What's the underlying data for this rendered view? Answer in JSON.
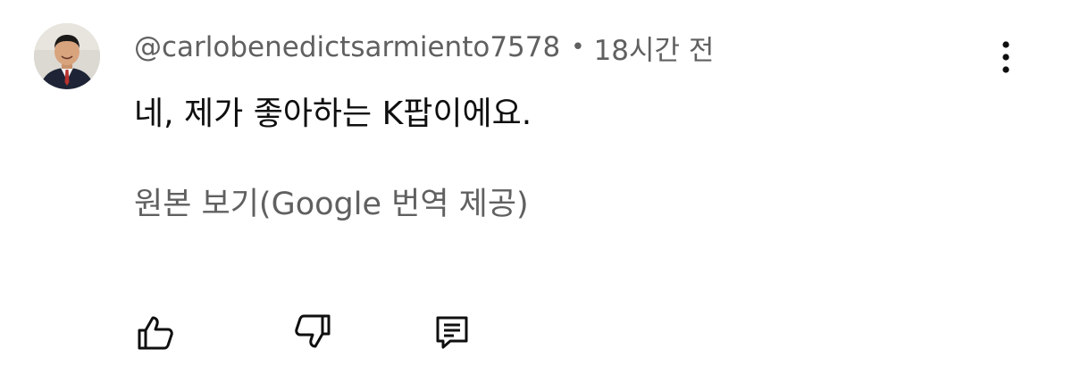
{
  "comment": {
    "author": "@carlobenedictsarmiento7578",
    "separator": "•",
    "timestamp": "18시간 전",
    "text": "네, 제가 좋아하는 K팝이에요.",
    "translate_link": "원본 보기(Google 번역 제공)"
  },
  "icons": {
    "menu": "more-vert-icon",
    "like": "thumbs-up-icon",
    "dislike": "thumbs-down-icon",
    "reply": "comment-icon"
  },
  "colors": {
    "primary_text": "#0f0f0f",
    "secondary_text": "#606060",
    "background": "#ffffff"
  }
}
